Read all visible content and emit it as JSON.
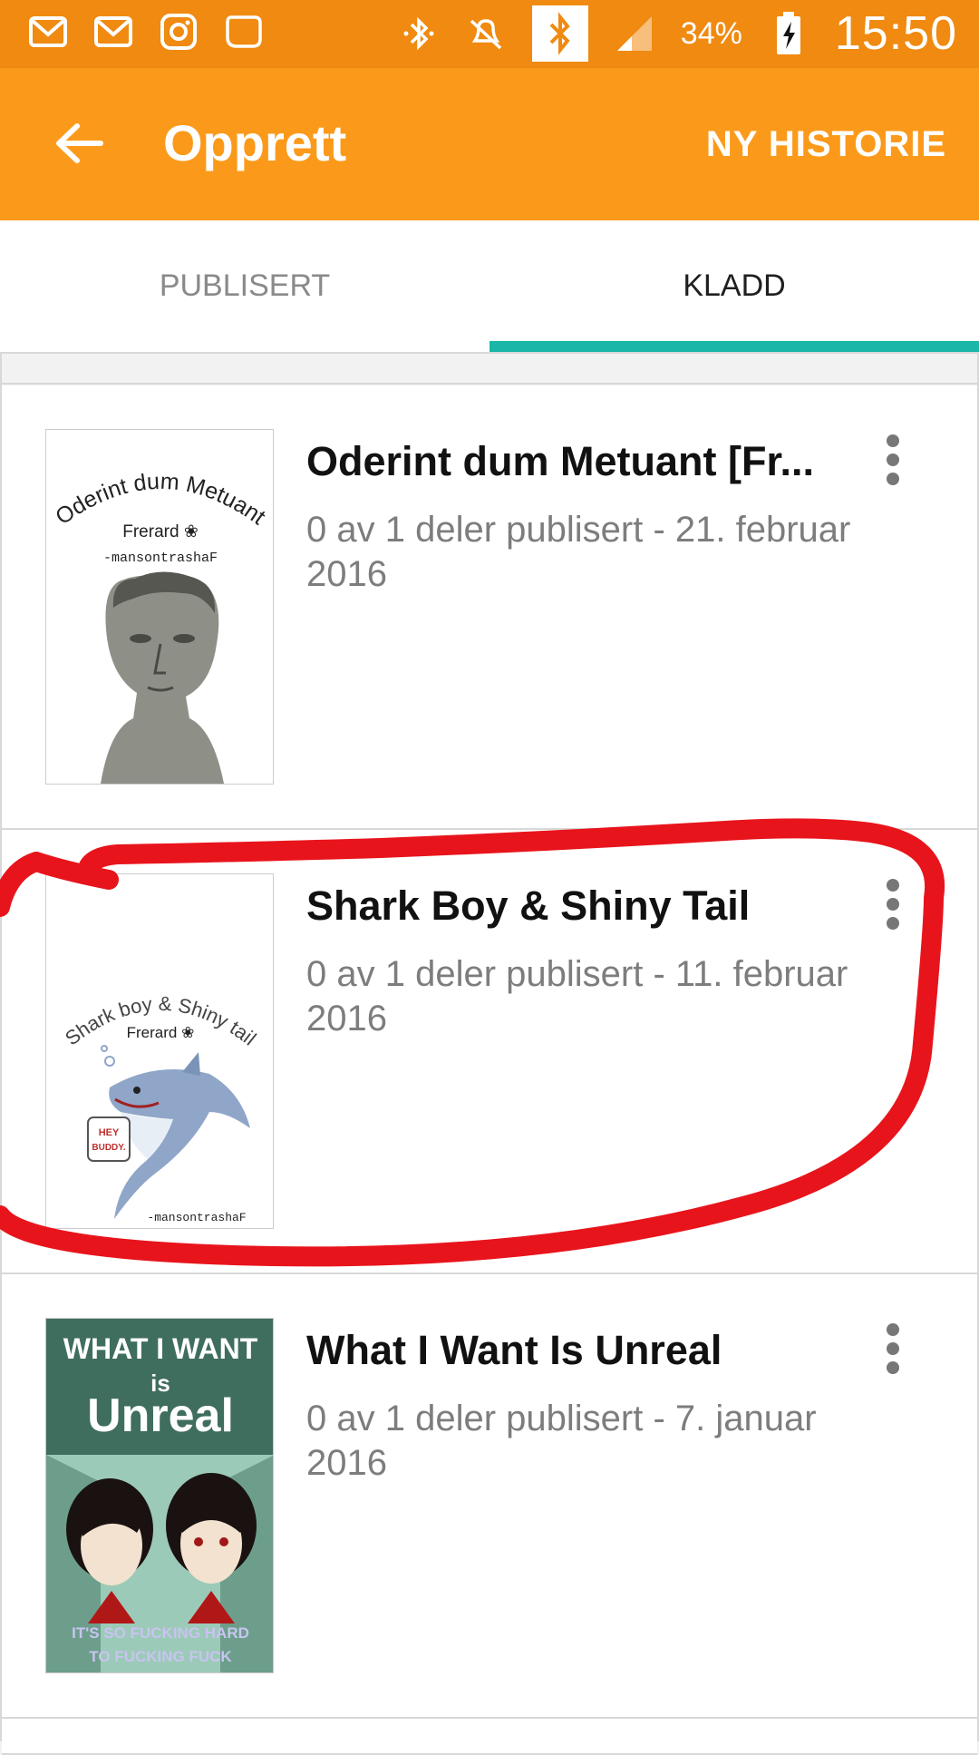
{
  "status_bar": {
    "icons_left": [
      "gmail-icon",
      "gmail-icon",
      "instagram-icon",
      "chat-bubble-icon"
    ],
    "icons_right": [
      "bluetooth-icon",
      "mute-icon",
      "bluetooth-icon",
      "signal-icon",
      "battery-charging-icon"
    ],
    "battery": "34%",
    "time": "15:50"
  },
  "app_bar": {
    "title": "Opprett",
    "action": "NY HISTORIE"
  },
  "tabs": [
    {
      "label": "PUBLISERT",
      "selected": false
    },
    {
      "label": "KLADD",
      "selected": true
    }
  ],
  "stories": [
    {
      "title": "Oderint dum Metuant [Fr...",
      "meta": "0 av 1 deler publisert - 21. februar 2016",
      "cover": {
        "title": "Oderint dum Metuant",
        "subtitle": "Frerard ❀",
        "author": "-mansontrashaF"
      }
    },
    {
      "title": "Shark Boy & Shiny Tail",
      "meta": "0 av 1 deler publisert - 11. februar 2016",
      "cover": {
        "title": "Shark boy & Shiny tail",
        "subtitle": "Frerard ❀",
        "speech": "HEY BUDDY.",
        "author": "-mansontrashaF"
      }
    },
    {
      "title": "What I Want Is Unreal",
      "meta": "0 av 1 deler publisert - 7. januar 2016",
      "cover": {
        "title_top": "WHAT I WANT",
        "title_mid": "is",
        "title_big": "Unreal",
        "bottom": "IT'S SO FUCKING HARD TO FUCKING FUCK"
      }
    }
  ],
  "colors": {
    "status_bar": "#f08a10",
    "app_bar": "#fb9a1a",
    "tab_indicator": "#1ab6a8",
    "annotation": "#e8141c"
  }
}
